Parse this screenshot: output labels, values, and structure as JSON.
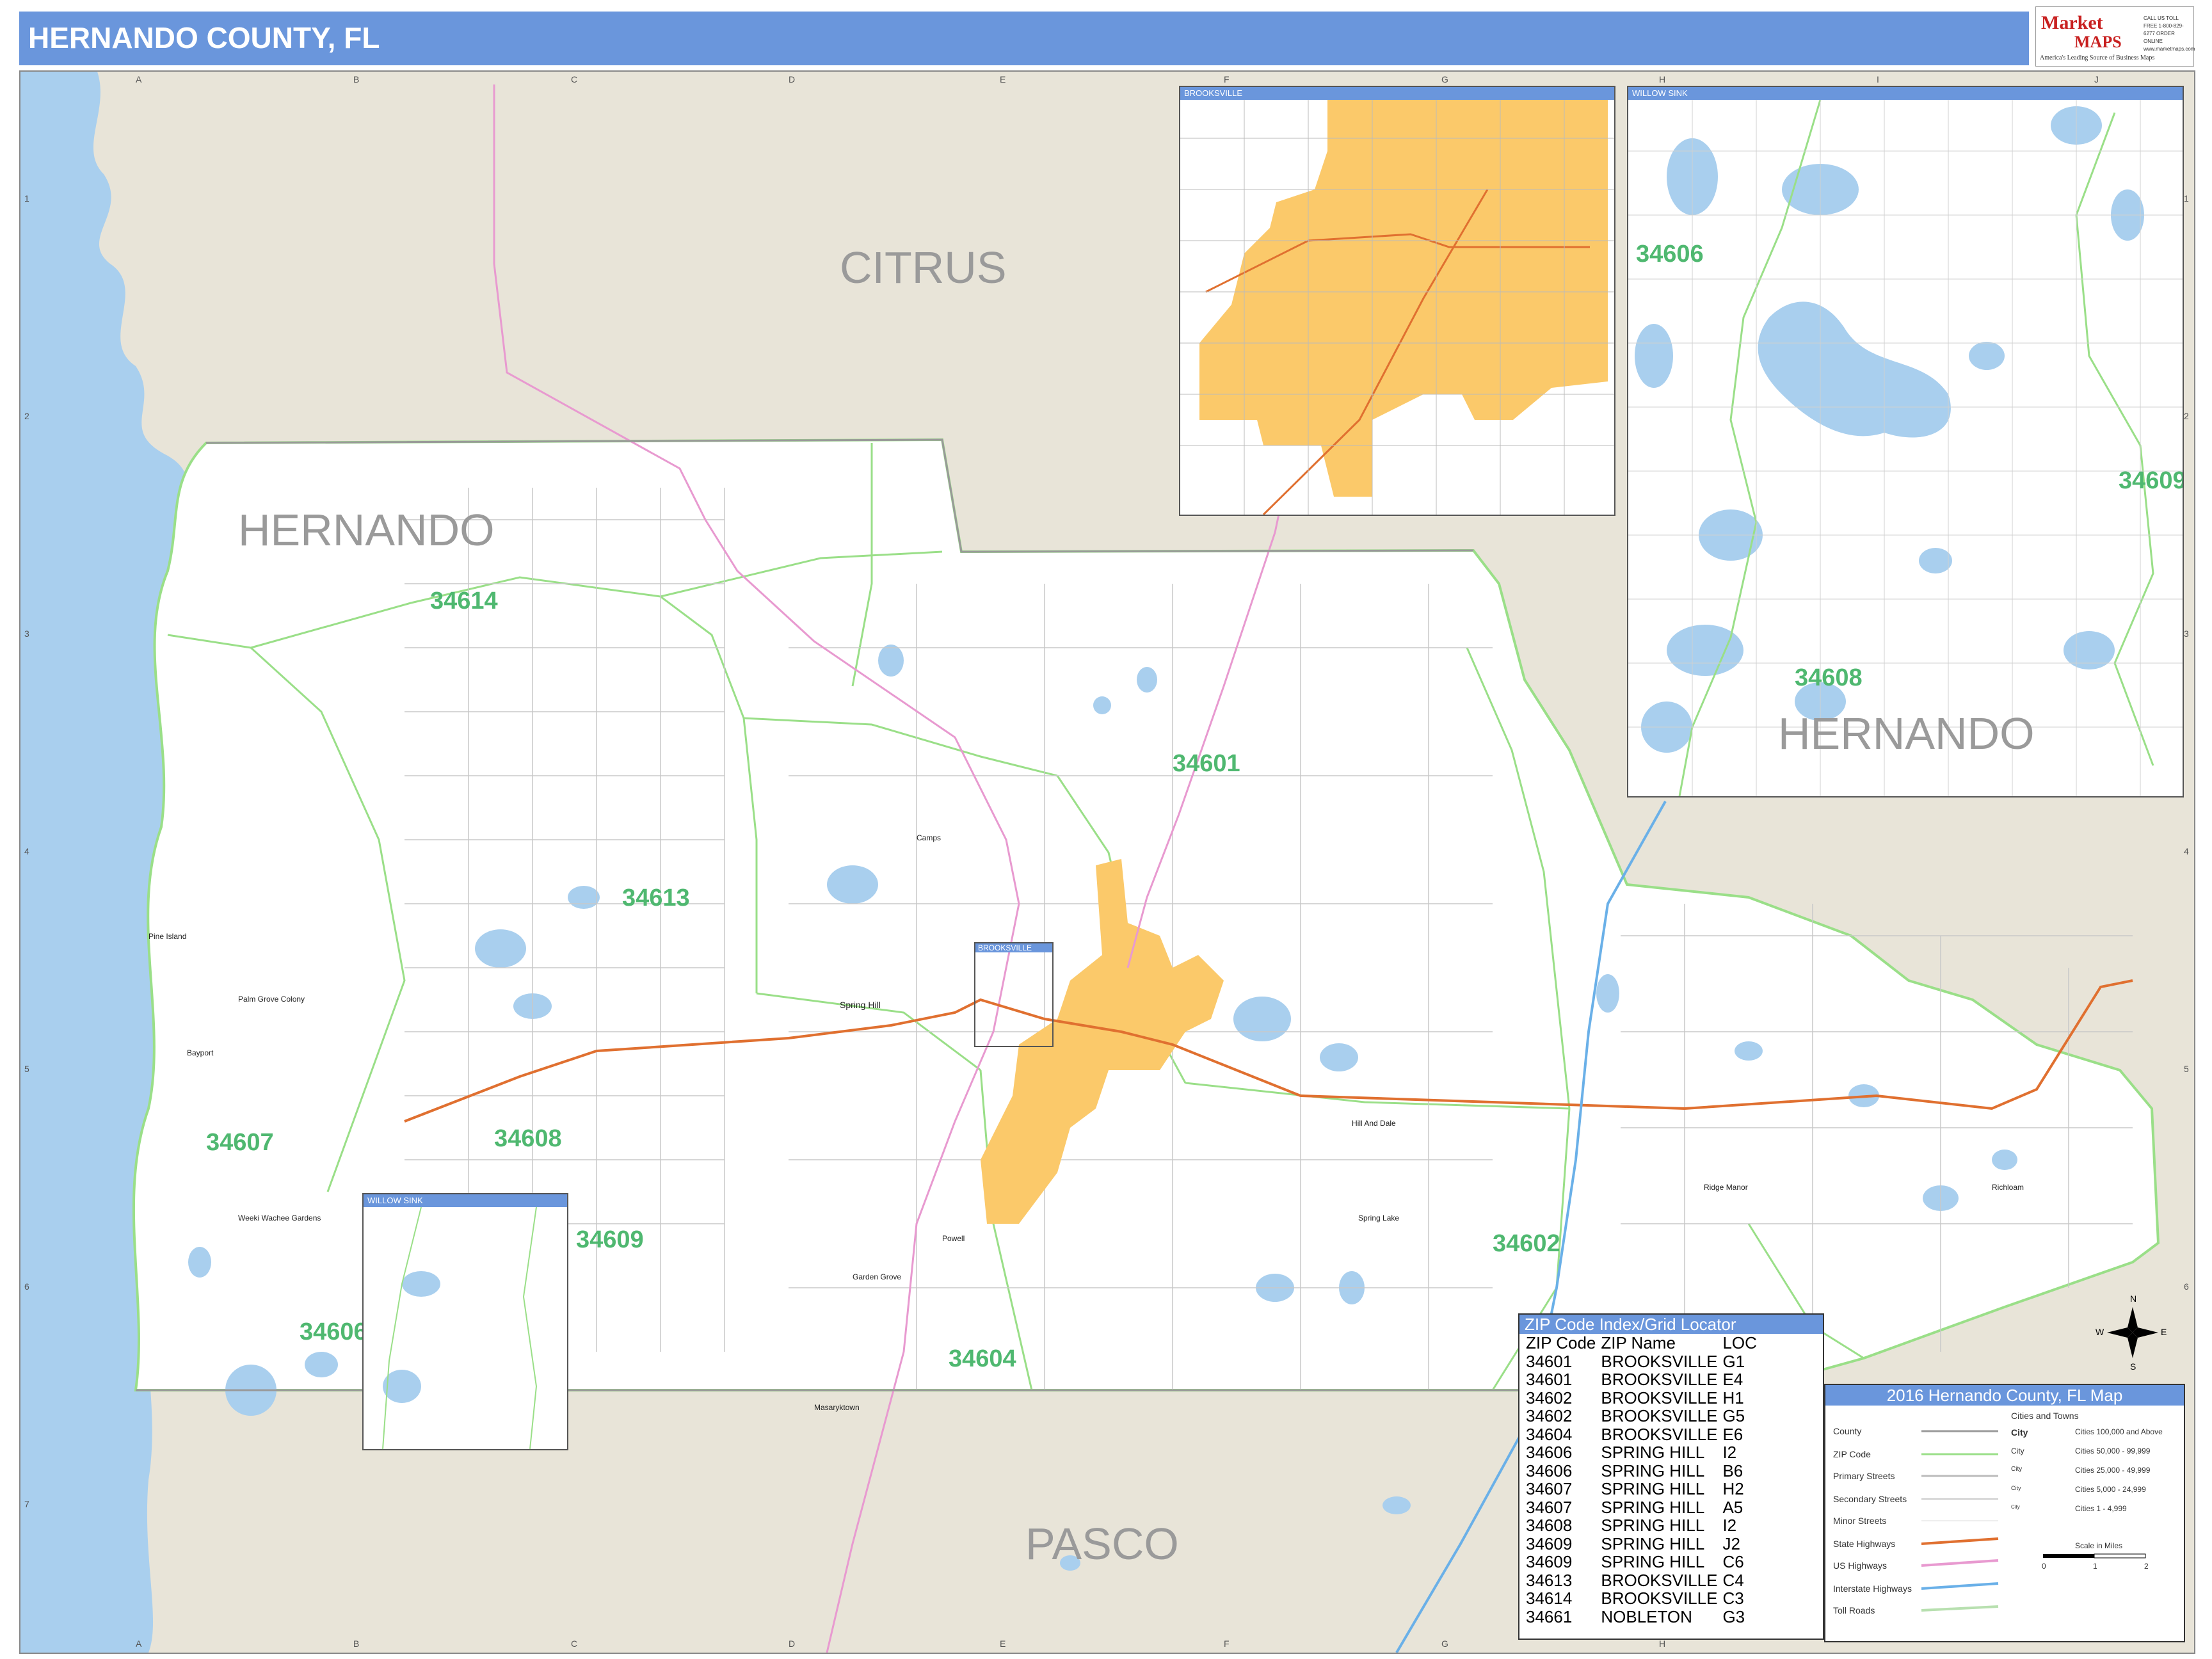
{
  "title": "HERNANDO COUNTY, FL",
  "brand": {
    "name_top": "Market",
    "name_bottom": "MAPS",
    "tagline": "America's Leading Source of Business Maps",
    "slogan": "On Target...On Time",
    "info": "CALL US TOLL FREE 1-800-829-6277 ORDER ONLINE www.marketmaps.com"
  },
  "grid": {
    "columns": [
      "A",
      "B",
      "C",
      "D",
      "E",
      "F",
      "G",
      "H",
      "I",
      "J"
    ],
    "rows": [
      "1",
      "2",
      "3",
      "4",
      "5",
      "6",
      "7"
    ]
  },
  "region_labels": {
    "citrus": "CITRUS",
    "hernando": "HERNANDO",
    "pasco": "PASCO"
  },
  "zip_labels": {
    "z34614": "34614",
    "z34601": "34601",
    "z34613": "34613",
    "z34607": "34607",
    "z34608": "34608",
    "z34609": "34609",
    "z34606": "34606",
    "z34604": "34604",
    "z34602": "34602"
  },
  "places": {
    "spring_hill": "Spring Hill",
    "brooksville": "BROOKSVILLE",
    "pine_island": "Pine Island",
    "palm_grove": "Palm Grove Colony",
    "bayport": "Bayport",
    "weeki_wachee": "Weeki Wachee Gardens",
    "hill_n_dale": "Hill And Dale",
    "ridge_manor": "Ridge Manor",
    "richloam": "Richloam",
    "spring_lake": "Spring Lake",
    "masaryktown": "Masaryktown",
    "garden_grove": "Garden Grove",
    "powell": "Powell",
    "camp_a": "Camps"
  },
  "insets": {
    "brooksville": {
      "title": "BROOKSVILLE"
    },
    "willow_sink": {
      "title": "WILLOW SINK",
      "zip_34606": "34606",
      "zip_34609": "34609",
      "zip_34608": "34608",
      "region": "HERNANDO"
    },
    "willow_sink_small": {
      "title": "WILLOW SINK"
    }
  },
  "zip_index": {
    "title": "ZIP Code Index/Grid Locator",
    "headers": [
      "ZIP Code",
      "ZIP Name",
      "LOC"
    ],
    "rows": [
      [
        "34601",
        "BROOKSVILLE",
        "G1"
      ],
      [
        "34601",
        "BROOKSVILLE",
        "E4"
      ],
      [
        "34602",
        "BROOKSVILLE",
        "H1"
      ],
      [
        "34602",
        "BROOKSVILLE",
        "G5"
      ],
      [
        "34604",
        "BROOKSVILLE",
        "E6"
      ],
      [
        "34606",
        "SPRING HILL",
        "I2"
      ],
      [
        "34606",
        "SPRING HILL",
        "B6"
      ],
      [
        "34607",
        "SPRING HILL",
        "H2"
      ],
      [
        "34607",
        "SPRING HILL",
        "A5"
      ],
      [
        "34608",
        "SPRING HILL",
        "I2"
      ],
      [
        "34609",
        "SPRING HILL",
        "J2"
      ],
      [
        "34609",
        "SPRING HILL",
        "C6"
      ],
      [
        "34613",
        "BROOKSVILLE",
        "C4"
      ],
      [
        "34614",
        "BROOKSVILLE",
        "C3"
      ],
      [
        "34661",
        "NOBLETON",
        "G3"
      ]
    ]
  },
  "legend": {
    "title": "2016 Hernando County, FL Map",
    "cities_header": "Cities and Towns",
    "items": [
      "County",
      "ZIP Code",
      "Primary Streets",
      "Secondary Streets",
      "Minor Streets",
      "State Highways",
      "US Highways",
      "Interstate Highways",
      "Toll Roads"
    ],
    "city_labels": [
      "City",
      "City",
      "City",
      "City",
      "City"
    ],
    "city_sizes": [
      "Cities 100,000 and Above",
      "Cities 50,000 - 99,999",
      "Cities 25,000 - 49,999",
      "Cities 5,000 - 24,999",
      "Cities 1 - 4,999"
    ],
    "scale_label": "Scale in Miles",
    "scale_ticks": [
      "0",
      "1",
      "2"
    ]
  },
  "compass": {
    "n": "N",
    "s": "S",
    "e": "E",
    "w": "W"
  },
  "colors": {
    "water": "#a9cfee",
    "land_outside": "#e8e4d8",
    "county": "#ffffff",
    "zip_line": "#99e08a",
    "city_fill": "#fbc96a",
    "zip_text": "#4fb870",
    "title_bar": "#6a96dc",
    "state_highway": "#e07030",
    "us_highway": "#e89ad0",
    "interstate": "#6ab0e8"
  }
}
